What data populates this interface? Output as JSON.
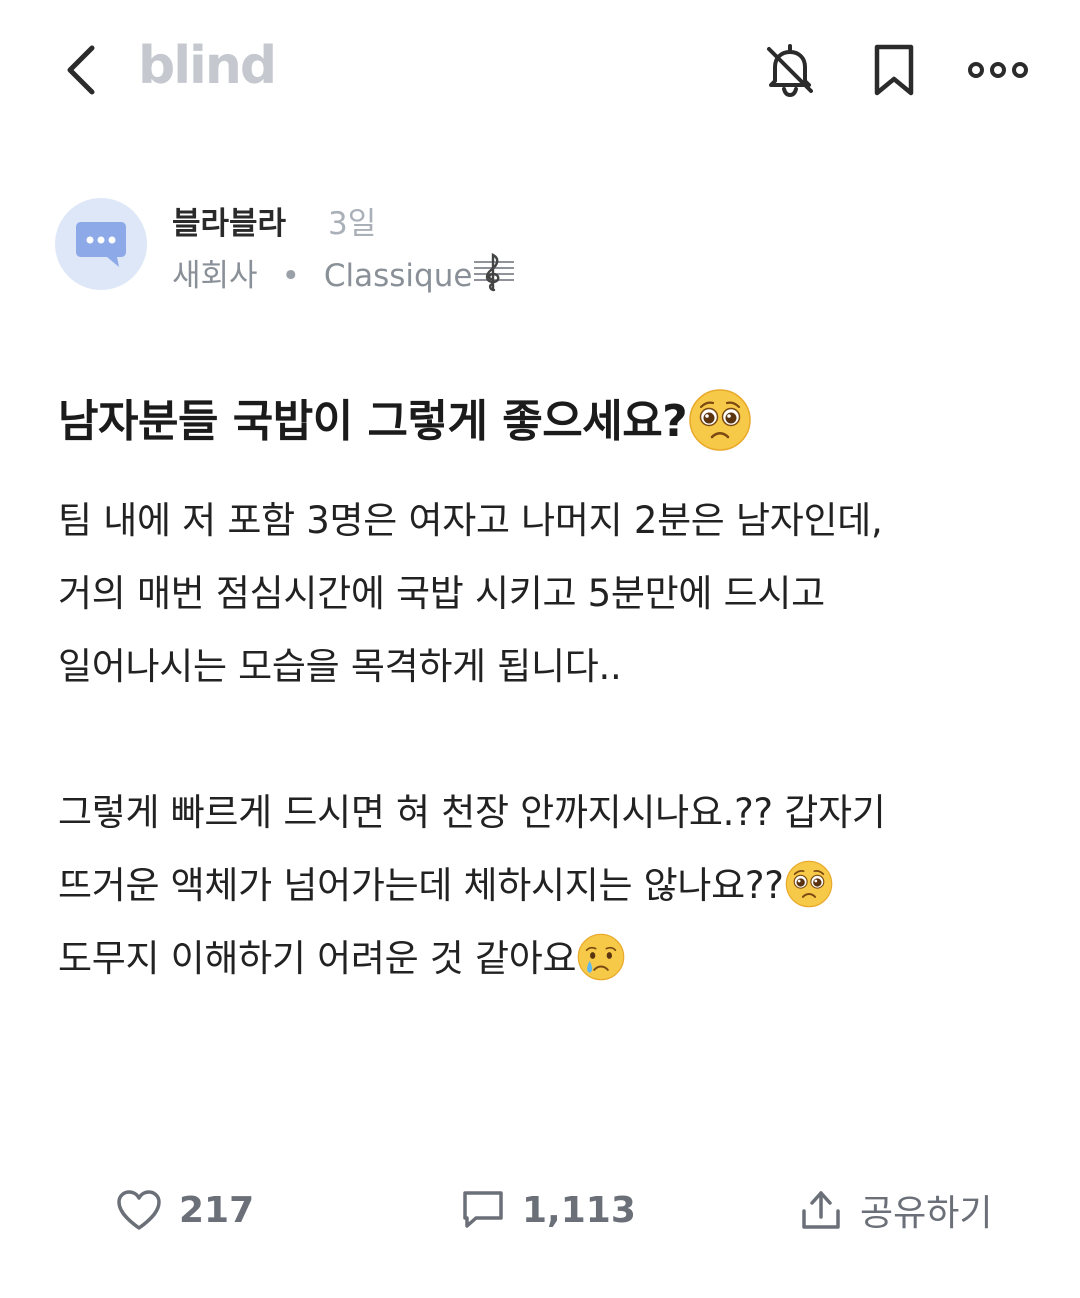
{
  "header": {
    "logo": "blind",
    "icons": [
      "back-arrow-icon",
      "bell-off-icon",
      "bookmark-icon",
      "more-icon"
    ]
  },
  "author": {
    "name": "블라블라",
    "time": "3일",
    "company": "새회사",
    "separator": "•",
    "nickname": "Classique",
    "nickname_icon": "treble-clef-icon"
  },
  "post": {
    "title": "남자분들 국밥이 그렇게 좋으세요?",
    "title_emoji": "pleading-face",
    "lines": [
      "팀 내에 저 포함 3명은 여자고 나머지 2분은 남자인데,",
      "거의 매번 점심시간에 국밥 시키고 5분만에 드시고",
      "일어나시는 모습을 목격하게 됩니다..",
      "",
      "그렇게 빠르게 드시면 혀 천장 안까지시나요.?? 갑자기",
      "뜨거운 액체가 넘어가는데 체하시지는 않나요??",
      "도무지 이해하기 어려운 것 같아요"
    ],
    "line6_emoji": "pleading-face",
    "line7_emoji": "crying-face"
  },
  "footer": {
    "likes": "217",
    "comments": "1,113",
    "share_label": "공유하기"
  },
  "colors": {
    "logo": "#c5c9cf",
    "avatar_bg": "#dde7f7",
    "avatar_fg": "#8ea9e8",
    "meta": "#8a9098",
    "footer": "#6b7078",
    "emoji": "#f7c948"
  }
}
